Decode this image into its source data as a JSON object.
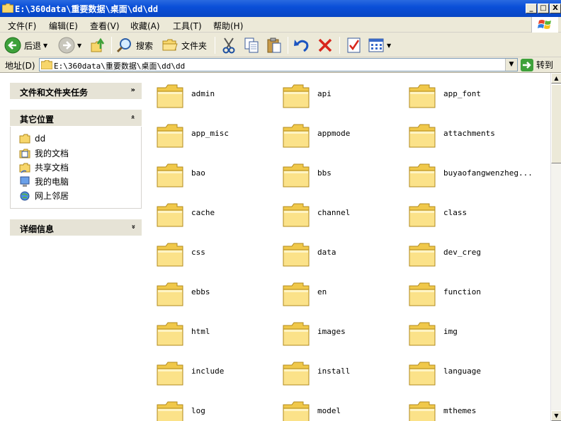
{
  "window": {
    "title": "E:\\360data\\重要数据\\桌面\\dd\\dd",
    "min_label": "_",
    "max_label": "□",
    "close_label": "X"
  },
  "menu": {
    "file": "文件(F)",
    "edit": "编辑(E)",
    "view": "查看(V)",
    "favorites": "收藏(A)",
    "tools": "工具(T)",
    "help": "帮助(H)"
  },
  "toolbar": {
    "back": "后退",
    "search": "搜索",
    "folders": "文件夹"
  },
  "address": {
    "label": "地址(D)",
    "path": "E:\\360data\\重要数据\\桌面\\dd\\dd",
    "go": "转到"
  },
  "tasks": {
    "file_tasks": "文件和文件夹任务",
    "other_places": "其它位置",
    "details": "详细信息",
    "places": [
      {
        "label": "dd",
        "icon": "folder-icon"
      },
      {
        "label": "我的文档",
        "icon": "my-documents-icon"
      },
      {
        "label": "共享文档",
        "icon": "shared-folder-icon"
      },
      {
        "label": "我的电脑",
        "icon": "my-computer-icon"
      },
      {
        "label": "网上邻居",
        "icon": "network-places-icon"
      }
    ]
  },
  "folders": [
    "admin",
    "api",
    "app_font",
    "app_misc",
    "appmode",
    "attachments",
    "bao",
    "bbs",
    "buyaofangwenzheg...",
    "cache",
    "channel",
    "class",
    "css",
    "data",
    "dev_creg",
    "ebbs",
    "en",
    "function",
    "html",
    "images",
    "img",
    "include",
    "install",
    "language",
    "log",
    "model",
    "mthemes"
  ],
  "colors": {
    "titlebar": "#0a4fd8",
    "folder": "#f5d76e",
    "panel_bg": "#ece9d8"
  }
}
